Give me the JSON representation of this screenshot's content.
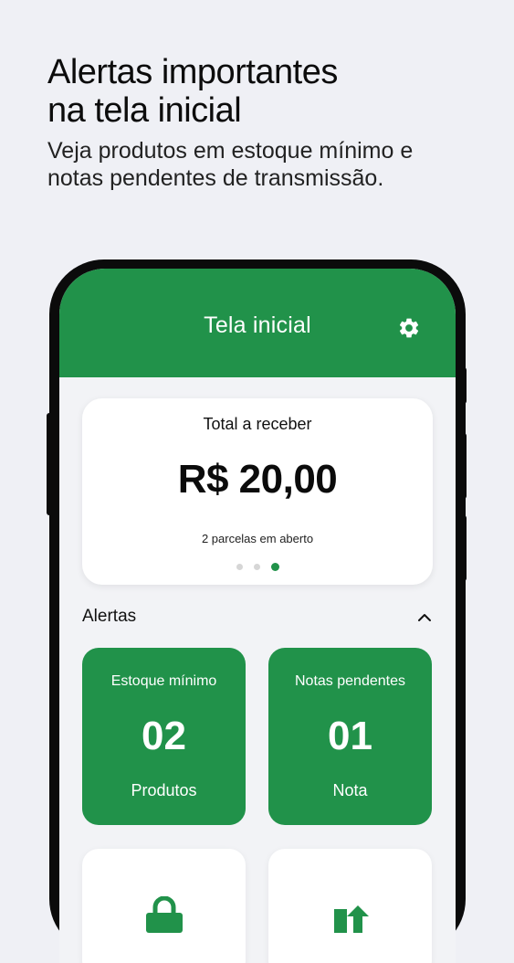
{
  "promo": {
    "headline_line1": "Alertas importantes",
    "headline_line2": "na tela inicial",
    "sub_line1": "Veja produtos em estoque mínimo e",
    "sub_line2": "notas pendentes de transmissão."
  },
  "appbar": {
    "title": "Tela inicial",
    "settings_icon": "gear-icon",
    "color": "#21924a"
  },
  "receivable": {
    "label": "Total a receber",
    "value": "R$ 20,00",
    "subtitle": "2 parcelas em aberto",
    "page_count": 3,
    "active_page": 3
  },
  "alerts": {
    "title": "Alertas",
    "collapse_icon": "chevron-up-icon",
    "tiles": [
      {
        "title": "Estoque mínimo",
        "count": "02",
        "unit": "Produtos"
      },
      {
        "title": "Notas pendentes",
        "count": "01",
        "unit": "Nota"
      }
    ],
    "shortcut_icons": [
      "shopping-bag-icon",
      "upload-arrow-icon"
    ]
  }
}
